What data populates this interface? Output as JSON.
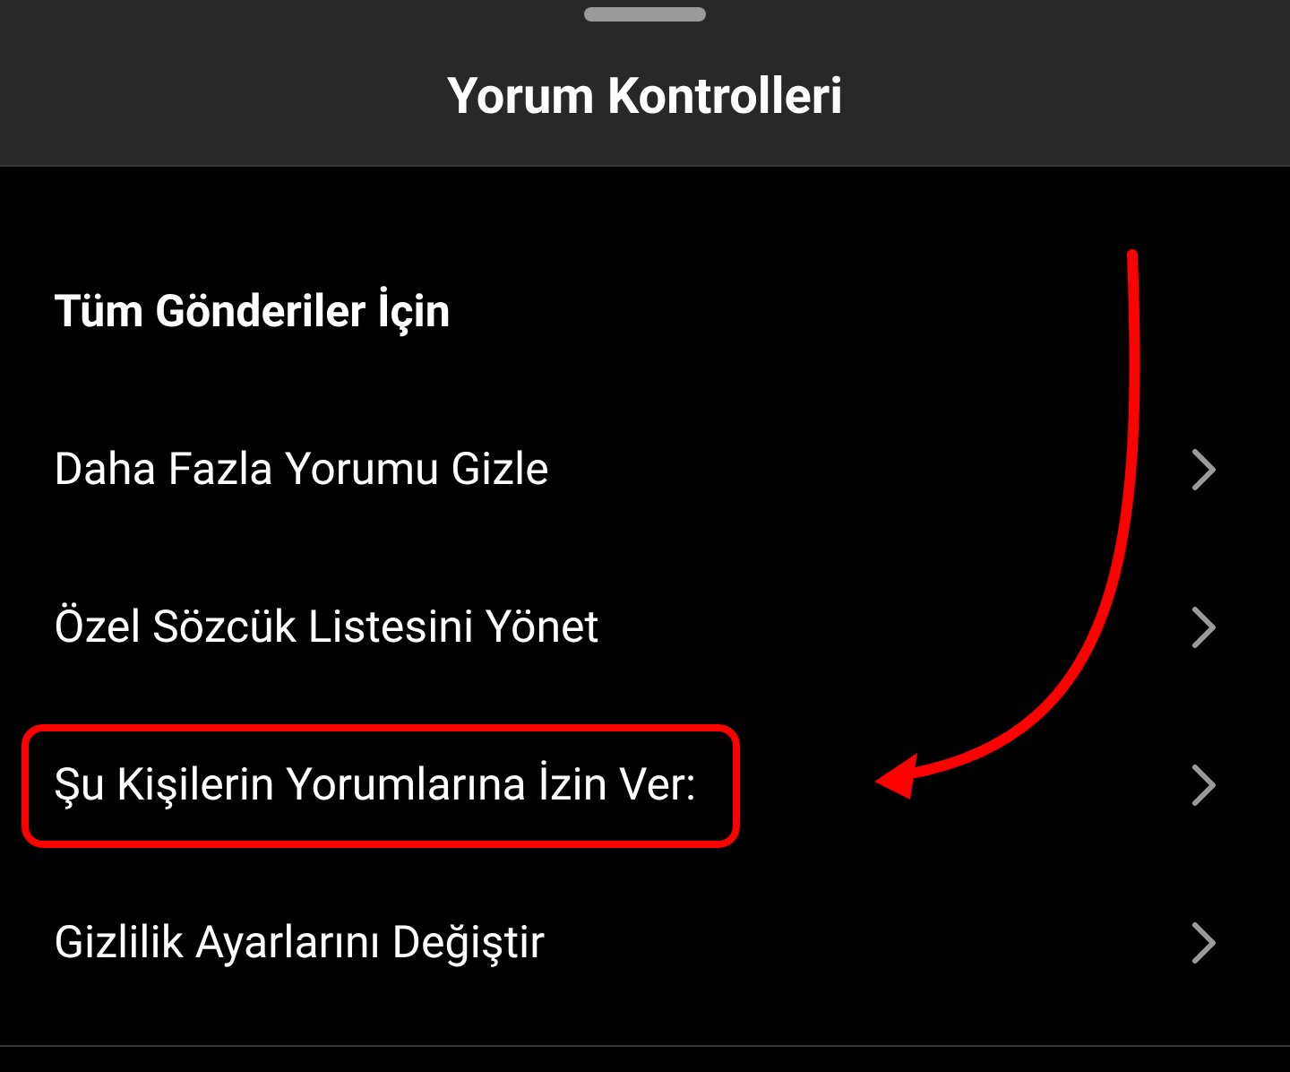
{
  "header": {
    "title": "Yorum Kontrolleri"
  },
  "section": {
    "heading": "Tüm Gönderiler İçin"
  },
  "items": [
    {
      "label": "Daha Fazla Yorumu Gizle",
      "highlighted": false
    },
    {
      "label": "Özel Sözcük Listesini Yönet",
      "highlighted": false
    },
    {
      "label": "Şu Kişilerin Yorumlarına İzin Ver:",
      "highlighted": true
    },
    {
      "label": "Gizlilik Ayarlarını Değiştir",
      "highlighted": false
    }
  ]
}
